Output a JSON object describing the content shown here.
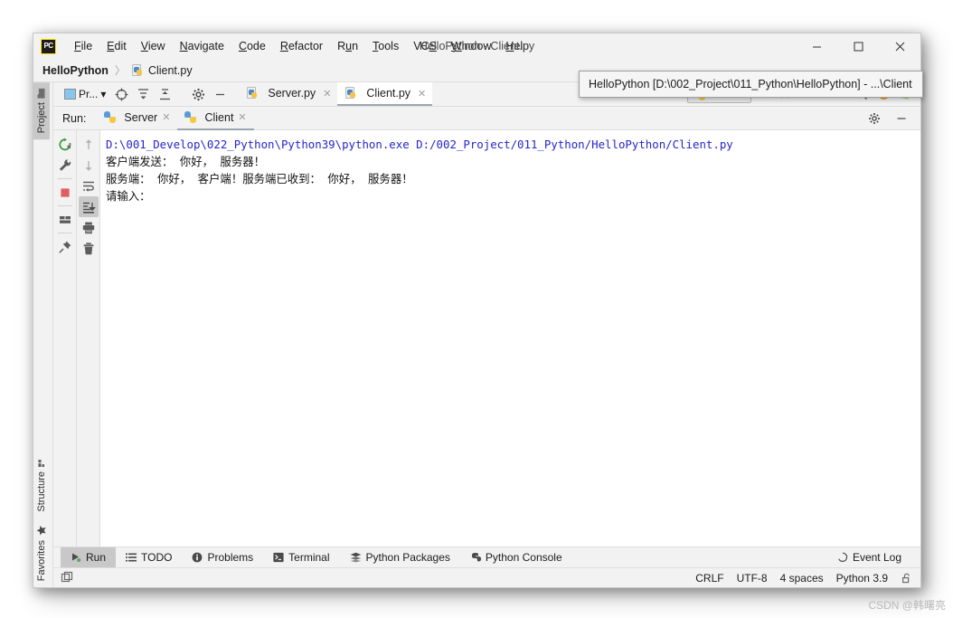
{
  "window": {
    "title": "HelloPython - Client.py",
    "logo_text": "PC",
    "minimize": "–",
    "maximize": "□",
    "close": "✕"
  },
  "menubar": {
    "items": [
      {
        "label": "File",
        "mnemonic": "F",
        "rest": "ile"
      },
      {
        "label": "Edit",
        "mnemonic": "E",
        "rest": "dit"
      },
      {
        "label": "View",
        "mnemonic": "V",
        "rest": "iew"
      },
      {
        "label": "Navigate",
        "mnemonic": "N",
        "rest": "avigate"
      },
      {
        "label": "Code",
        "mnemonic": "C",
        "rest": "ode"
      },
      {
        "label": "Refactor",
        "mnemonic": "R",
        "rest": "efactor"
      },
      {
        "label": "Run",
        "mnemonic": "u",
        "pre": "R",
        "rest": "n"
      },
      {
        "label": "Tools",
        "mnemonic": "T",
        "rest": "ools"
      },
      {
        "label": "VCS",
        "mnemonic": "S",
        "pre": "VC",
        "rest": ""
      },
      {
        "label": "Window",
        "mnemonic": "W",
        "rest": "indow"
      },
      {
        "label": "Help",
        "mnemonic": "H",
        "rest": "elp"
      }
    ]
  },
  "breadcrumb": {
    "project": "HelloPython",
    "separator": "〉",
    "file": "Client.py"
  },
  "left_stripe": {
    "project_tab": "Project",
    "structure_tab": "Structure",
    "favorites_tab": "Favorites"
  },
  "editor_toolbar": {
    "project_selector": "Pr...",
    "dropdown_arrow": "▾",
    "icons": [
      "locate-icon",
      "collapse-all-icon",
      "expand-all-icon",
      "settings-icon",
      "hide-icon"
    ],
    "file_tabs": [
      {
        "label": "Server.py",
        "active": false,
        "close": "✕"
      },
      {
        "label": "Client.py",
        "active": true,
        "close": "✕"
      }
    ],
    "run_config": "Client"
  },
  "run_panel": {
    "label": "Run:",
    "tabs": [
      {
        "label": "Server",
        "active": false,
        "close": "✕"
      },
      {
        "label": "Client",
        "active": true,
        "close": "✕"
      }
    ],
    "settings_icon": "gear-icon",
    "minimize_icon": "minimize-icon",
    "gutter_left": [
      "rerun-icon",
      "wrench-icon",
      "stop-icon",
      "layout-icon",
      "pin-icon"
    ],
    "gutter_right": [
      "up-arrow-icon",
      "down-arrow-icon",
      "soft-wrap-icon",
      "scroll-to-end-icon",
      "print-icon",
      "trash-icon"
    ],
    "console_lines": [
      {
        "text": "D:\\001_Develop\\022_Python\\Python39\\python.exe D:/002_Project/011_Python/HelloPython/Client.py",
        "type": "cmd"
      },
      {
        "text": "客户端发送： 你好， 服务器！",
        "type": "out"
      },
      {
        "text": "服务端： 你好， 客户端！服务端已收到： 你好， 服务器！",
        "type": "out"
      },
      {
        "text": "请输入：",
        "type": "out"
      }
    ]
  },
  "bottom_tabs": {
    "items": [
      {
        "label": "Run",
        "icon": "run-icon",
        "active": true
      },
      {
        "label": "TODO",
        "icon": "todo-icon",
        "active": false
      },
      {
        "label": "Problems",
        "icon": "problems-icon",
        "active": false
      },
      {
        "label": "Terminal",
        "icon": "terminal-icon",
        "active": false
      },
      {
        "label": "Python Packages",
        "icon": "packages-icon",
        "active": false
      },
      {
        "label": "Python Console",
        "icon": "python-console-icon",
        "active": false
      }
    ],
    "event_log": "Event Log",
    "event_log_icon": "event-log-icon"
  },
  "statusbar": {
    "line_separator": "CRLF",
    "encoding": "UTF-8",
    "indent": "4 spaces",
    "interpreter": "Python 3.9",
    "lock_icon": "unlocked-icon",
    "left_icon": "toggle-toolwindows-icon"
  },
  "tooltip": {
    "text": "HelloPython [D:\\002_Project\\011_Python\\HelloPython] - ...\\Client"
  },
  "watermark": {
    "text": "CSDN @韩曙亮"
  },
  "colors": {
    "accent_blue": "#2525cc",
    "panel_bg": "#f2f2f2",
    "console_bg": "#ffffff",
    "tab_active": "#c8c8c8",
    "python_blue": "#4a86c8",
    "python_yellow": "#f6c444",
    "stop_red": "#e05c62",
    "rerun_green": "#3ca03c"
  }
}
